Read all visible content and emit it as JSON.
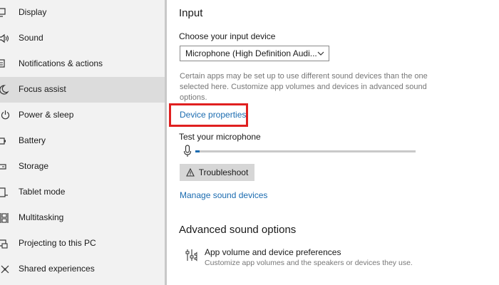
{
  "sidebar": {
    "items": [
      {
        "label": "Display",
        "icon": "display-icon",
        "active": false
      },
      {
        "label": "Sound",
        "icon": "speaker-icon",
        "active": false
      },
      {
        "label": "Notifications & actions",
        "icon": "notifications-icon",
        "active": false
      },
      {
        "label": "Focus assist",
        "icon": "moon-icon",
        "active": true
      },
      {
        "label": "Power & sleep",
        "icon": "power-icon",
        "active": false
      },
      {
        "label": "Battery",
        "icon": "battery-icon",
        "active": false
      },
      {
        "label": "Storage",
        "icon": "storage-icon",
        "active": false
      },
      {
        "label": "Tablet mode",
        "icon": "tablet-icon",
        "active": false
      },
      {
        "label": "Multitasking",
        "icon": "multitasking-icon",
        "active": false
      },
      {
        "label": "Projecting to this PC",
        "icon": "projector-icon",
        "active": false
      },
      {
        "label": "Shared experiences",
        "icon": "shared-experiences-icon",
        "active": false
      }
    ]
  },
  "input": {
    "heading": "Input",
    "choose_label": "Choose your input device",
    "selected_device": "Microphone (High Definition Audi...",
    "help_text": "Certain apps may be set up to use different sound devices than the one selected here. Customize app volumes and devices in advanced sound options.",
    "device_properties_link": "Device properties",
    "test_label": "Test your microphone",
    "mic_level_fraction": 0.02,
    "troubleshoot_label": "Troubleshoot",
    "manage_link": "Manage sound devices"
  },
  "advanced": {
    "heading": "Advanced sound options",
    "app_volume_title": "App volume and device preferences",
    "app_volume_desc": "Customize app volumes and the speakers or devices they use."
  },
  "colors": {
    "accent": "#1a6bb0",
    "highlight_box": "#e02020",
    "sidebar_bg": "#f2f2f2",
    "active_item_bg": "#dcdcdc"
  }
}
